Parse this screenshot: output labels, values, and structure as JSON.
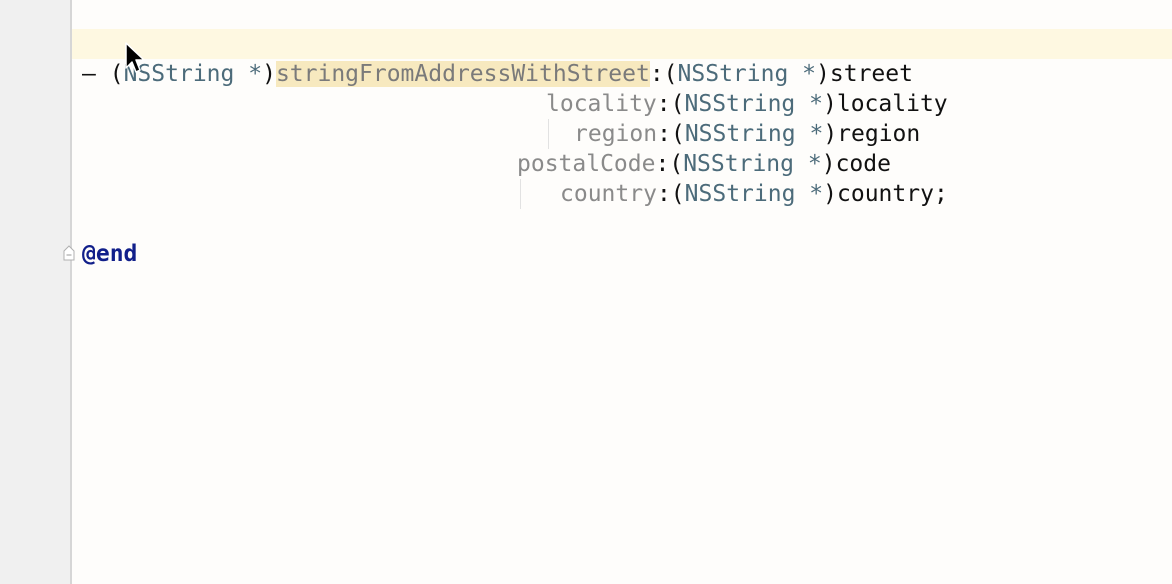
{
  "editor": {
    "method_signature": {
      "dash": "–",
      "return_open": "(",
      "return_type": "NSString",
      "return_ptr": "*",
      "return_close": ")",
      "method_name": "stringFromAddressWithStreet",
      "lines": [
        {
          "selector": "",
          "type": "NSString",
          "ptr": "*",
          "param": "street",
          "terminator": ""
        },
        {
          "selector": "locality",
          "type": "NSString",
          "ptr": "*",
          "param": "locality",
          "terminator": ""
        },
        {
          "selector": "region",
          "type": "NSString",
          "ptr": "*",
          "param": "region",
          "terminator": ""
        },
        {
          "selector": "postalCode",
          "type": "NSString",
          "ptr": "*",
          "param": "code",
          "terminator": ""
        },
        {
          "selector": "country",
          "type": "NSString",
          "ptr": "*",
          "param": "country",
          "terminator": ";"
        }
      ]
    },
    "end_directive": "@end",
    "icons": {
      "fold": "fold-marker-icon",
      "cursor": "mouse-pointer-icon"
    },
    "colors": {
      "current_line": "#fef8e1",
      "method_highlight": "#f7e9bf",
      "type": "#4c6b7a",
      "directive": "#111f8a"
    }
  }
}
